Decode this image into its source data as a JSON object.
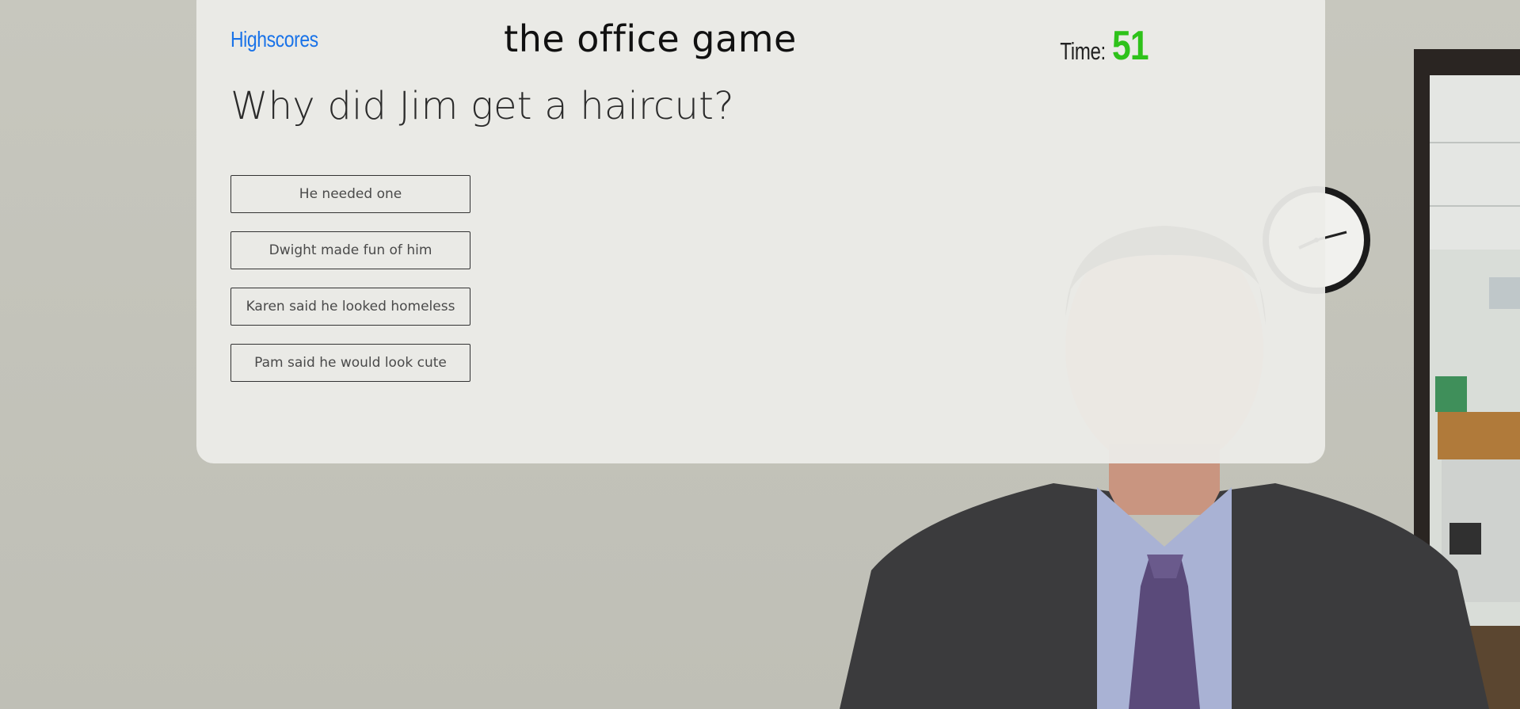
{
  "header": {
    "highscores_link": "Highscores",
    "game_title": "the office game",
    "timer_label": "Time:",
    "timer_value": "51"
  },
  "quiz": {
    "question": "Why did Jim get a haircut?",
    "answers": [
      "He needed one",
      "Dwight made fun of him",
      "Karen said he looked homeless",
      "Pam said he would look cute"
    ]
  },
  "colors": {
    "link": "#1a73e8",
    "timer": "#2ec21a",
    "card_background": "#ececE9",
    "page_background": "#c4c4bb"
  },
  "background_image": {
    "icons": [
      "wall-clock-icon",
      "office-door-icon"
    ]
  }
}
